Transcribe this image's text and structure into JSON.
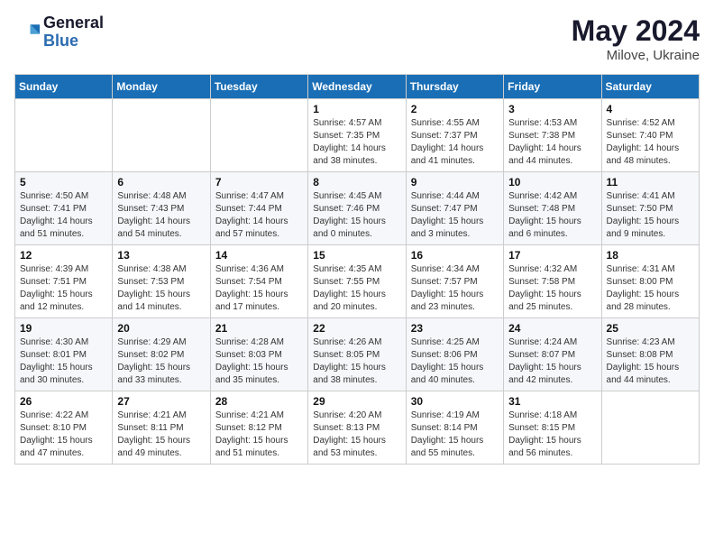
{
  "header": {
    "logo_line1": "General",
    "logo_line2": "Blue",
    "month_year": "May 2024",
    "location": "Milove, Ukraine"
  },
  "weekdays": [
    "Sunday",
    "Monday",
    "Tuesday",
    "Wednesday",
    "Thursday",
    "Friday",
    "Saturday"
  ],
  "weeks": [
    [
      {
        "day": "",
        "sunrise": "",
        "sunset": "",
        "daylight": ""
      },
      {
        "day": "",
        "sunrise": "",
        "sunset": "",
        "daylight": ""
      },
      {
        "day": "",
        "sunrise": "",
        "sunset": "",
        "daylight": ""
      },
      {
        "day": "1",
        "sunrise": "Sunrise: 4:57 AM",
        "sunset": "Sunset: 7:35 PM",
        "daylight": "Daylight: 14 hours and 38 minutes."
      },
      {
        "day": "2",
        "sunrise": "Sunrise: 4:55 AM",
        "sunset": "Sunset: 7:37 PM",
        "daylight": "Daylight: 14 hours and 41 minutes."
      },
      {
        "day": "3",
        "sunrise": "Sunrise: 4:53 AM",
        "sunset": "Sunset: 7:38 PM",
        "daylight": "Daylight: 14 hours and 44 minutes."
      },
      {
        "day": "4",
        "sunrise": "Sunrise: 4:52 AM",
        "sunset": "Sunset: 7:40 PM",
        "daylight": "Daylight: 14 hours and 48 minutes."
      }
    ],
    [
      {
        "day": "5",
        "sunrise": "Sunrise: 4:50 AM",
        "sunset": "Sunset: 7:41 PM",
        "daylight": "Daylight: 14 hours and 51 minutes."
      },
      {
        "day": "6",
        "sunrise": "Sunrise: 4:48 AM",
        "sunset": "Sunset: 7:43 PM",
        "daylight": "Daylight: 14 hours and 54 minutes."
      },
      {
        "day": "7",
        "sunrise": "Sunrise: 4:47 AM",
        "sunset": "Sunset: 7:44 PM",
        "daylight": "Daylight: 14 hours and 57 minutes."
      },
      {
        "day": "8",
        "sunrise": "Sunrise: 4:45 AM",
        "sunset": "Sunset: 7:46 PM",
        "daylight": "Daylight: 15 hours and 0 minutes."
      },
      {
        "day": "9",
        "sunrise": "Sunrise: 4:44 AM",
        "sunset": "Sunset: 7:47 PM",
        "daylight": "Daylight: 15 hours and 3 minutes."
      },
      {
        "day": "10",
        "sunrise": "Sunrise: 4:42 AM",
        "sunset": "Sunset: 7:48 PM",
        "daylight": "Daylight: 15 hours and 6 minutes."
      },
      {
        "day": "11",
        "sunrise": "Sunrise: 4:41 AM",
        "sunset": "Sunset: 7:50 PM",
        "daylight": "Daylight: 15 hours and 9 minutes."
      }
    ],
    [
      {
        "day": "12",
        "sunrise": "Sunrise: 4:39 AM",
        "sunset": "Sunset: 7:51 PM",
        "daylight": "Daylight: 15 hours and 12 minutes."
      },
      {
        "day": "13",
        "sunrise": "Sunrise: 4:38 AM",
        "sunset": "Sunset: 7:53 PM",
        "daylight": "Daylight: 15 hours and 14 minutes."
      },
      {
        "day": "14",
        "sunrise": "Sunrise: 4:36 AM",
        "sunset": "Sunset: 7:54 PM",
        "daylight": "Daylight: 15 hours and 17 minutes."
      },
      {
        "day": "15",
        "sunrise": "Sunrise: 4:35 AM",
        "sunset": "Sunset: 7:55 PM",
        "daylight": "Daylight: 15 hours and 20 minutes."
      },
      {
        "day": "16",
        "sunrise": "Sunrise: 4:34 AM",
        "sunset": "Sunset: 7:57 PM",
        "daylight": "Daylight: 15 hours and 23 minutes."
      },
      {
        "day": "17",
        "sunrise": "Sunrise: 4:32 AM",
        "sunset": "Sunset: 7:58 PM",
        "daylight": "Daylight: 15 hours and 25 minutes."
      },
      {
        "day": "18",
        "sunrise": "Sunrise: 4:31 AM",
        "sunset": "Sunset: 8:00 PM",
        "daylight": "Daylight: 15 hours and 28 minutes."
      }
    ],
    [
      {
        "day": "19",
        "sunrise": "Sunrise: 4:30 AM",
        "sunset": "Sunset: 8:01 PM",
        "daylight": "Daylight: 15 hours and 30 minutes."
      },
      {
        "day": "20",
        "sunrise": "Sunrise: 4:29 AM",
        "sunset": "Sunset: 8:02 PM",
        "daylight": "Daylight: 15 hours and 33 minutes."
      },
      {
        "day": "21",
        "sunrise": "Sunrise: 4:28 AM",
        "sunset": "Sunset: 8:03 PM",
        "daylight": "Daylight: 15 hours and 35 minutes."
      },
      {
        "day": "22",
        "sunrise": "Sunrise: 4:26 AM",
        "sunset": "Sunset: 8:05 PM",
        "daylight": "Daylight: 15 hours and 38 minutes."
      },
      {
        "day": "23",
        "sunrise": "Sunrise: 4:25 AM",
        "sunset": "Sunset: 8:06 PM",
        "daylight": "Daylight: 15 hours and 40 minutes."
      },
      {
        "day": "24",
        "sunrise": "Sunrise: 4:24 AM",
        "sunset": "Sunset: 8:07 PM",
        "daylight": "Daylight: 15 hours and 42 minutes."
      },
      {
        "day": "25",
        "sunrise": "Sunrise: 4:23 AM",
        "sunset": "Sunset: 8:08 PM",
        "daylight": "Daylight: 15 hours and 44 minutes."
      }
    ],
    [
      {
        "day": "26",
        "sunrise": "Sunrise: 4:22 AM",
        "sunset": "Sunset: 8:10 PM",
        "daylight": "Daylight: 15 hours and 47 minutes."
      },
      {
        "day": "27",
        "sunrise": "Sunrise: 4:21 AM",
        "sunset": "Sunset: 8:11 PM",
        "daylight": "Daylight: 15 hours and 49 minutes."
      },
      {
        "day": "28",
        "sunrise": "Sunrise: 4:21 AM",
        "sunset": "Sunset: 8:12 PM",
        "daylight": "Daylight: 15 hours and 51 minutes."
      },
      {
        "day": "29",
        "sunrise": "Sunrise: 4:20 AM",
        "sunset": "Sunset: 8:13 PM",
        "daylight": "Daylight: 15 hours and 53 minutes."
      },
      {
        "day": "30",
        "sunrise": "Sunrise: 4:19 AM",
        "sunset": "Sunset: 8:14 PM",
        "daylight": "Daylight: 15 hours and 55 minutes."
      },
      {
        "day": "31",
        "sunrise": "Sunrise: 4:18 AM",
        "sunset": "Sunset: 8:15 PM",
        "daylight": "Daylight: 15 hours and 56 minutes."
      },
      {
        "day": "",
        "sunrise": "",
        "sunset": "",
        "daylight": ""
      }
    ]
  ]
}
